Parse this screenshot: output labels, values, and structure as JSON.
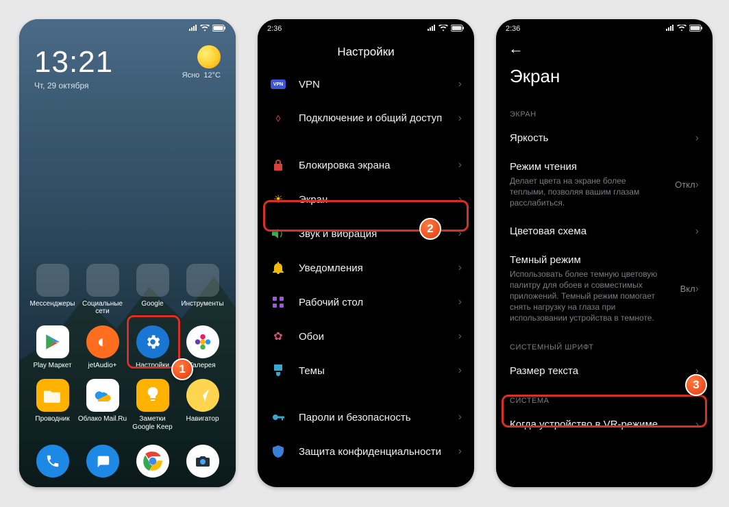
{
  "screen1": {
    "clock_time": "13:21",
    "clock_date": "Чт, 29 октября",
    "weather_text": "Ясно",
    "weather_temp": "12°C",
    "folders": [
      "Мессенджеры",
      "Социальные сети",
      "Google",
      "Инструменты"
    ],
    "apps_row2": [
      {
        "label": "Play Маркет"
      },
      {
        "label": "jetAudio+"
      },
      {
        "label": "Настройки"
      },
      {
        "label": "Галерея"
      }
    ],
    "apps_row3": [
      {
        "label": "Проводник"
      },
      {
        "label": "Облако Mail.Ru"
      },
      {
        "label": "Заметки Google Keep"
      },
      {
        "label": "Навигатор"
      }
    ],
    "step1": "1"
  },
  "screen2": {
    "time": "2:36",
    "title": "Настройки",
    "items": {
      "vpn": "VPN",
      "share": "Подключение и общий доступ",
      "lock": "Блокировка экрана",
      "display": "Экран",
      "sound": "Звук и вибрация",
      "notif": "Уведомления",
      "desk": "Рабочий стол",
      "wall": "Обои",
      "themes": "Темы",
      "security": "Пароли и безопасность",
      "privacy": "Защита конфиденциальности"
    },
    "step2": "2"
  },
  "screen3": {
    "time": "2:36",
    "title": "Экран",
    "section1": "ЭКРАН",
    "brightness": "Яркость",
    "reading_title": "Режим чтения",
    "reading_sub": "Делает цвета на экране более теплыми, позволяя вашим глазам расслабиться.",
    "reading_status": "Откл",
    "colors": "Цветовая схема",
    "dark_title": "Темный режим",
    "dark_sub": "Использовать более темную цветовую палитру для обоев и совместимых приложений. Темный режим помогает снять нагрузку на глаза при использовании устройства в темноте.",
    "dark_status": "Вкл",
    "section2": "СИСТЕМНЫЙ ШРИФТ",
    "text_size": "Размер текста",
    "section3": "СИСТЕМА",
    "vr": "Когда устройство в VR-режиме",
    "step3": "3"
  }
}
